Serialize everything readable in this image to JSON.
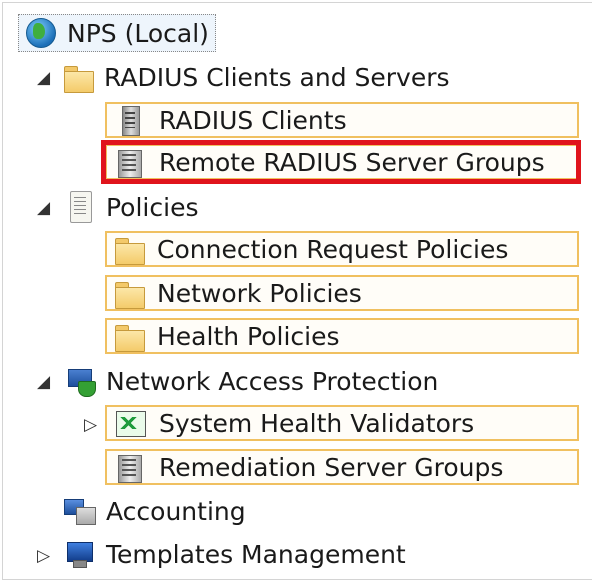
{
  "tree": {
    "root": {
      "label": "NPS (Local)",
      "icon": "globe-icon"
    },
    "radius_clients_and_servers": {
      "label": "RADIUS Clients and Servers",
      "icon": "folder-icon",
      "children": [
        {
          "label": "RADIUS Clients",
          "icon": "server-icon"
        },
        {
          "label": "Remote RADIUS Server Groups",
          "icon": "server-group-icon"
        }
      ]
    },
    "policies": {
      "label": "Policies",
      "icon": "policies-icon",
      "children": [
        {
          "label": "Connection Request Policies",
          "icon": "folder-icon"
        },
        {
          "label": "Network Policies",
          "icon": "folder-icon"
        },
        {
          "label": "Health Policies",
          "icon": "folder-icon"
        }
      ]
    },
    "network_access_protection": {
      "label": "Network Access Protection",
      "icon": "network-icon",
      "children": [
        {
          "label": "System Health Validators",
          "icon": "validators-icon"
        },
        {
          "label": "Remediation Server Groups",
          "icon": "server-group-icon"
        }
      ]
    },
    "accounting": {
      "label": "Accounting",
      "icon": "accounting-icon"
    },
    "templates_management": {
      "label": "Templates Management",
      "icon": "templates-icon"
    }
  },
  "colors": {
    "highlight": "#e0141c",
    "item_border": "#f0c060"
  },
  "glyphs": {
    "expanded": "◢",
    "collapsed": "▷"
  }
}
